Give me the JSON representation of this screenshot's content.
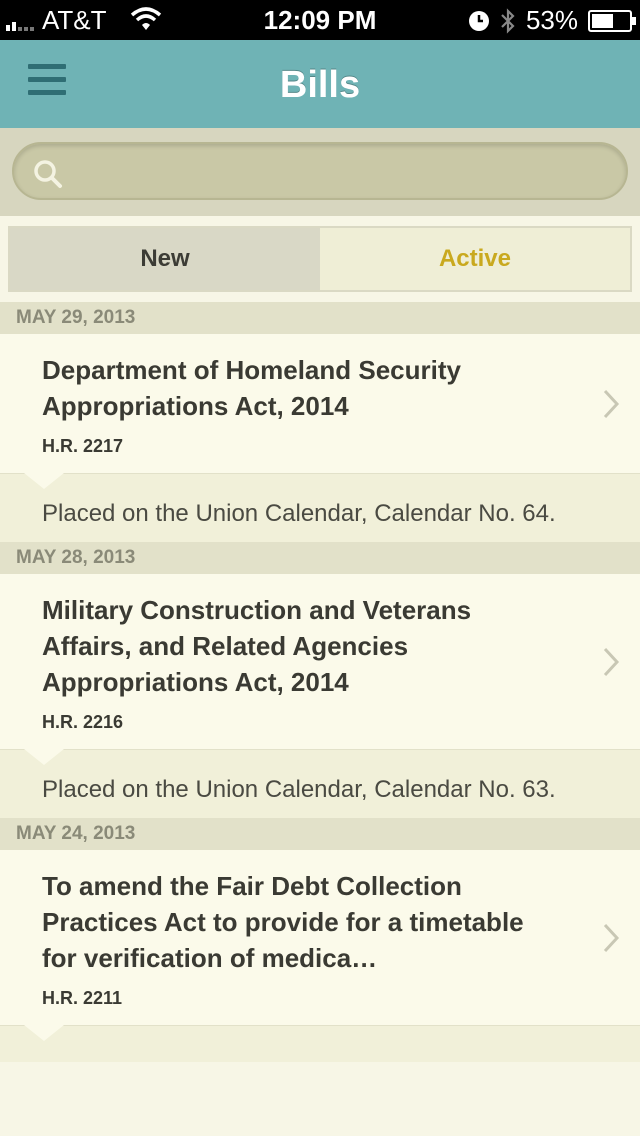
{
  "statusbar": {
    "carrier": "AT&T",
    "time": "12:09 PM",
    "battery": "53%",
    "battery_level": 0.53
  },
  "navbar": {
    "title": "Bills",
    "menu_icon": "hamburger-icon"
  },
  "search": {
    "placeholder": "",
    "value": ""
  },
  "segments": {
    "new_label": "New",
    "active_label": "Active",
    "selected": "Active"
  },
  "sections": [
    {
      "date": "MAY 29, 2013",
      "bill": {
        "title": "Department of Homeland Security Appropriations Act, 2014",
        "number": "H.R. 2217",
        "status": "Placed on the Union Calendar, Calendar No. 64."
      }
    },
    {
      "date": "MAY 28, 2013",
      "bill": {
        "title": "Military Construction and Veterans Affairs, and Related Agencies Appropriations Act, 2014",
        "number": "H.R. 2216",
        "status": "Placed on the Union Calendar, Calendar No. 63."
      }
    },
    {
      "date": "MAY 24, 2013",
      "bill": {
        "title": "To amend the Fair Debt Collection Practices Act to provide for a timetable for verification of medica…",
        "number": "H.R. 2211",
        "status": ""
      }
    }
  ],
  "colors": {
    "navbar": "#6fb3b5",
    "active_tab": "#c9a91f"
  }
}
